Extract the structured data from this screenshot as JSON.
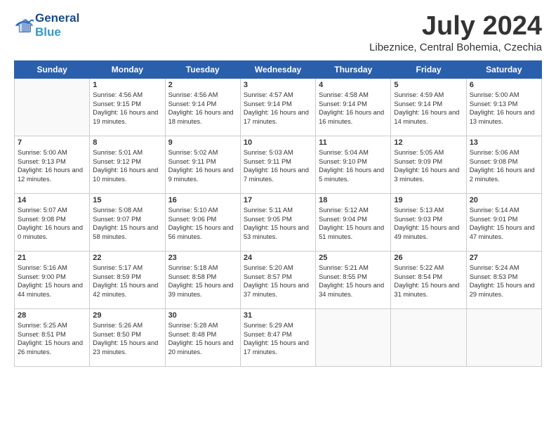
{
  "header": {
    "logo_line1": "General",
    "logo_line2": "Blue",
    "month": "July 2024",
    "location": "Libeznice, Central Bohemia, Czechia"
  },
  "weekdays": [
    "Sunday",
    "Monday",
    "Tuesday",
    "Wednesday",
    "Thursday",
    "Friday",
    "Saturday"
  ],
  "weeks": [
    [
      {
        "day": "",
        "sunrise": "",
        "sunset": "",
        "daylight": ""
      },
      {
        "day": "1",
        "sunrise": "Sunrise: 4:56 AM",
        "sunset": "Sunset: 9:15 PM",
        "daylight": "Daylight: 16 hours and 19 minutes."
      },
      {
        "day": "2",
        "sunrise": "Sunrise: 4:56 AM",
        "sunset": "Sunset: 9:14 PM",
        "daylight": "Daylight: 16 hours and 18 minutes."
      },
      {
        "day": "3",
        "sunrise": "Sunrise: 4:57 AM",
        "sunset": "Sunset: 9:14 PM",
        "daylight": "Daylight: 16 hours and 17 minutes."
      },
      {
        "day": "4",
        "sunrise": "Sunrise: 4:58 AM",
        "sunset": "Sunset: 9:14 PM",
        "daylight": "Daylight: 16 hours and 16 minutes."
      },
      {
        "day": "5",
        "sunrise": "Sunrise: 4:59 AM",
        "sunset": "Sunset: 9:14 PM",
        "daylight": "Daylight: 16 hours and 14 minutes."
      },
      {
        "day": "6",
        "sunrise": "Sunrise: 5:00 AM",
        "sunset": "Sunset: 9:13 PM",
        "daylight": "Daylight: 16 hours and 13 minutes."
      }
    ],
    [
      {
        "day": "7",
        "sunrise": "Sunrise: 5:00 AM",
        "sunset": "Sunset: 9:13 PM",
        "daylight": "Daylight: 16 hours and 12 minutes."
      },
      {
        "day": "8",
        "sunrise": "Sunrise: 5:01 AM",
        "sunset": "Sunset: 9:12 PM",
        "daylight": "Daylight: 16 hours and 10 minutes."
      },
      {
        "day": "9",
        "sunrise": "Sunrise: 5:02 AM",
        "sunset": "Sunset: 9:11 PM",
        "daylight": "Daylight: 16 hours and 9 minutes."
      },
      {
        "day": "10",
        "sunrise": "Sunrise: 5:03 AM",
        "sunset": "Sunset: 9:11 PM",
        "daylight": "Daylight: 16 hours and 7 minutes."
      },
      {
        "day": "11",
        "sunrise": "Sunrise: 5:04 AM",
        "sunset": "Sunset: 9:10 PM",
        "daylight": "Daylight: 16 hours and 5 minutes."
      },
      {
        "day": "12",
        "sunrise": "Sunrise: 5:05 AM",
        "sunset": "Sunset: 9:09 PM",
        "daylight": "Daylight: 16 hours and 3 minutes."
      },
      {
        "day": "13",
        "sunrise": "Sunrise: 5:06 AM",
        "sunset": "Sunset: 9:08 PM",
        "daylight": "Daylight: 16 hours and 2 minutes."
      }
    ],
    [
      {
        "day": "14",
        "sunrise": "Sunrise: 5:07 AM",
        "sunset": "Sunset: 9:08 PM",
        "daylight": "Daylight: 16 hours and 0 minutes."
      },
      {
        "day": "15",
        "sunrise": "Sunrise: 5:08 AM",
        "sunset": "Sunset: 9:07 PM",
        "daylight": "Daylight: 15 hours and 58 minutes."
      },
      {
        "day": "16",
        "sunrise": "Sunrise: 5:10 AM",
        "sunset": "Sunset: 9:06 PM",
        "daylight": "Daylight: 15 hours and 56 minutes."
      },
      {
        "day": "17",
        "sunrise": "Sunrise: 5:11 AM",
        "sunset": "Sunset: 9:05 PM",
        "daylight": "Daylight: 15 hours and 53 minutes."
      },
      {
        "day": "18",
        "sunrise": "Sunrise: 5:12 AM",
        "sunset": "Sunset: 9:04 PM",
        "daylight": "Daylight: 15 hours and 51 minutes."
      },
      {
        "day": "19",
        "sunrise": "Sunrise: 5:13 AM",
        "sunset": "Sunset: 9:03 PM",
        "daylight": "Daylight: 15 hours and 49 minutes."
      },
      {
        "day": "20",
        "sunrise": "Sunrise: 5:14 AM",
        "sunset": "Sunset: 9:01 PM",
        "daylight": "Daylight: 15 hours and 47 minutes."
      }
    ],
    [
      {
        "day": "21",
        "sunrise": "Sunrise: 5:16 AM",
        "sunset": "Sunset: 9:00 PM",
        "daylight": "Daylight: 15 hours and 44 minutes."
      },
      {
        "day": "22",
        "sunrise": "Sunrise: 5:17 AM",
        "sunset": "Sunset: 8:59 PM",
        "daylight": "Daylight: 15 hours and 42 minutes."
      },
      {
        "day": "23",
        "sunrise": "Sunrise: 5:18 AM",
        "sunset": "Sunset: 8:58 PM",
        "daylight": "Daylight: 15 hours and 39 minutes."
      },
      {
        "day": "24",
        "sunrise": "Sunrise: 5:20 AM",
        "sunset": "Sunset: 8:57 PM",
        "daylight": "Daylight: 15 hours and 37 minutes."
      },
      {
        "day": "25",
        "sunrise": "Sunrise: 5:21 AM",
        "sunset": "Sunset: 8:55 PM",
        "daylight": "Daylight: 15 hours and 34 minutes."
      },
      {
        "day": "26",
        "sunrise": "Sunrise: 5:22 AM",
        "sunset": "Sunset: 8:54 PM",
        "daylight": "Daylight: 15 hours and 31 minutes."
      },
      {
        "day": "27",
        "sunrise": "Sunrise: 5:24 AM",
        "sunset": "Sunset: 8:53 PM",
        "daylight": "Daylight: 15 hours and 29 minutes."
      }
    ],
    [
      {
        "day": "28",
        "sunrise": "Sunrise: 5:25 AM",
        "sunset": "Sunset: 8:51 PM",
        "daylight": "Daylight: 15 hours and 26 minutes."
      },
      {
        "day": "29",
        "sunrise": "Sunrise: 5:26 AM",
        "sunset": "Sunset: 8:50 PM",
        "daylight": "Daylight: 15 hours and 23 minutes."
      },
      {
        "day": "30",
        "sunrise": "Sunrise: 5:28 AM",
        "sunset": "Sunset: 8:48 PM",
        "daylight": "Daylight: 15 hours and 20 minutes."
      },
      {
        "day": "31",
        "sunrise": "Sunrise: 5:29 AM",
        "sunset": "Sunset: 8:47 PM",
        "daylight": "Daylight: 15 hours and 17 minutes."
      },
      {
        "day": "",
        "sunrise": "",
        "sunset": "",
        "daylight": ""
      },
      {
        "day": "",
        "sunrise": "",
        "sunset": "",
        "daylight": ""
      },
      {
        "day": "",
        "sunrise": "",
        "sunset": "",
        "daylight": ""
      }
    ]
  ]
}
